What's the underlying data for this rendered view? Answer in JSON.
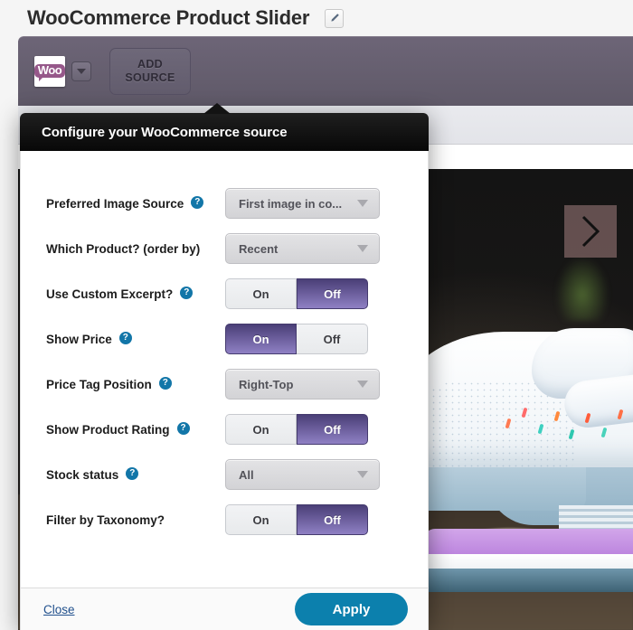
{
  "page": {
    "title": "WooCommerce Product Slider",
    "edit_icon": "pencil-icon"
  },
  "toolbar": {
    "source_chip_label": "Woo",
    "source_chip_icon": "woocommerce-logo-icon",
    "chip_caret_icon": "chevron-down-icon",
    "add_source_label": "ADD\nSOURCE",
    "add_source_line1": "ADD",
    "add_source_line2": "SOURCE"
  },
  "slide": {
    "next_arrow_icon": "chevron-right-icon"
  },
  "modal": {
    "header_title": "Configure your WooCommerce source",
    "help_glyph": "?",
    "fields": [
      {
        "label": "Preferred Image Source",
        "help": true,
        "control": "select",
        "value": "First image in co...",
        "name": "preferred-image-source"
      },
      {
        "label": "Which Product? (order by)",
        "help": false,
        "control": "select",
        "value": "Recent",
        "name": "which-product-order-by"
      },
      {
        "label": "Use Custom Excerpt?",
        "help": true,
        "control": "toggle",
        "on_label": "On",
        "off_label": "Off",
        "selected": "Off",
        "name": "use-custom-excerpt"
      },
      {
        "label": "Show Price",
        "help": true,
        "control": "toggle",
        "on_label": "On",
        "off_label": "Off",
        "selected": "On",
        "name": "show-price"
      },
      {
        "label": "Price Tag Position",
        "help": true,
        "control": "select",
        "value": "Right-Top",
        "name": "price-tag-position"
      },
      {
        "label": "Show Product Rating",
        "help": true,
        "control": "toggle",
        "on_label": "On",
        "off_label": "Off",
        "selected": "Off",
        "name": "show-product-rating"
      },
      {
        "label": "Stock status",
        "help": true,
        "control": "select",
        "value": "All",
        "name": "stock-status"
      },
      {
        "label": "Filter by Taxonomy?",
        "help": false,
        "control": "toggle",
        "on_label": "On",
        "off_label": "Off",
        "selected": "Off",
        "name": "filter-by-taxonomy"
      }
    ],
    "footer": {
      "close_label": "Close",
      "apply_label": "Apply"
    }
  },
  "colors": {
    "accent_blue": "#0c80ad",
    "help_blue": "#1276a8",
    "toggle_active_top": "#4a3f77",
    "toggle_active_bottom": "#8f80c4",
    "toolbar_purple": "#6d6577",
    "woo_magenta": "#96588a",
    "modal_header_black": "#131313"
  }
}
